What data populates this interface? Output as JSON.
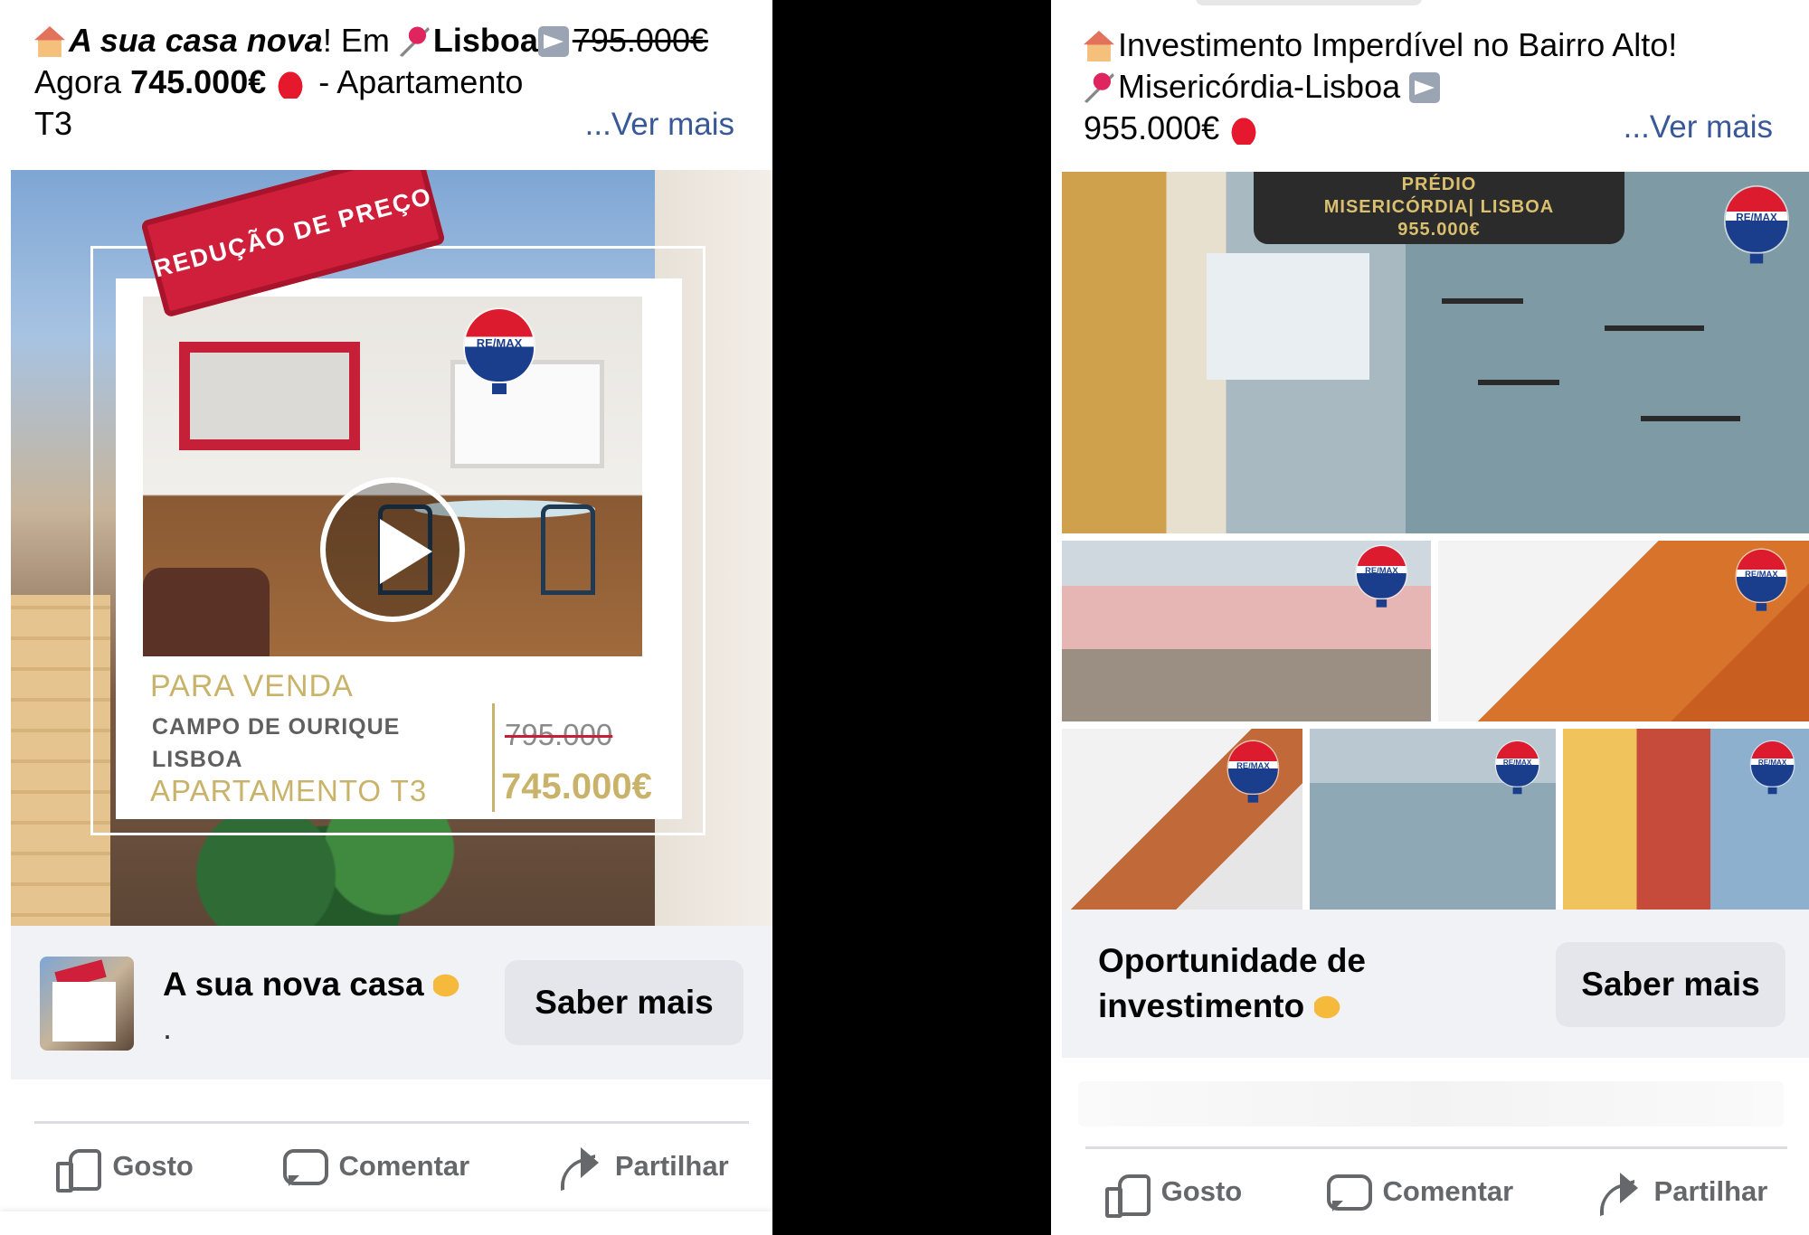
{
  "posts": [
    {
      "text": {
        "line1_prefix": "A sua casa nova",
        "line1_mid": "! Em ",
        "line1_city": "Lisboa",
        "line1_old_price": "795.000€",
        "line2_prefix": "Agora ",
        "line2_price": "745.000€",
        "line2_suffix": " - Apartamento",
        "line3": "T3",
        "see_more": "...Ver mais"
      },
      "media": {
        "stamp": "REDUÇÃO DE PREÇO",
        "remax": "RE/MAX",
        "sale": "PARA VENDA",
        "area_line1": "CAMPO DE OURIQUE",
        "area_line2": "LISBOA",
        "type": "APARTAMENTO T3",
        "old_price": "795.000",
        "new_price": "745.000€"
      },
      "cta": {
        "title": "A sua nova casa",
        "subtitle": ".",
        "button": "Saber mais"
      },
      "actions": {
        "like": "Gosto",
        "comment": "Comentar",
        "share": "Partilhar"
      }
    },
    {
      "text": {
        "line1": "Investimento Imperdível no Bairro Alto!",
        "line2": "Misericórdia-Lisboa",
        "line3": "955.000€",
        "see_more": "...Ver mais"
      },
      "media": {
        "banner_line1": "PRÉDIO",
        "banner_line2": "MISERICÓRDIA| LISBOA",
        "banner_line3": "955.000€",
        "remax": "RE/MAX"
      },
      "cta": {
        "title": "Oportunidade de investimento",
        "button": "Saber mais"
      },
      "actions": {
        "like": "Gosto",
        "comment": "Comentar",
        "share": "Partilhar"
      }
    }
  ],
  "colors": {
    "link": "#385898",
    "gold": "#c9b36a",
    "red": "#cf1f3a",
    "cta_bg": "#f0f2f5",
    "button_bg": "#e4e6eb"
  },
  "icons": [
    "house-emoji",
    "pin-emoji",
    "arrow-right-emoji",
    "siren-emoji",
    "pointing-hand-emoji",
    "play-icon",
    "like-icon",
    "comment-icon",
    "share-icon",
    "remax-balloon-logo"
  ]
}
